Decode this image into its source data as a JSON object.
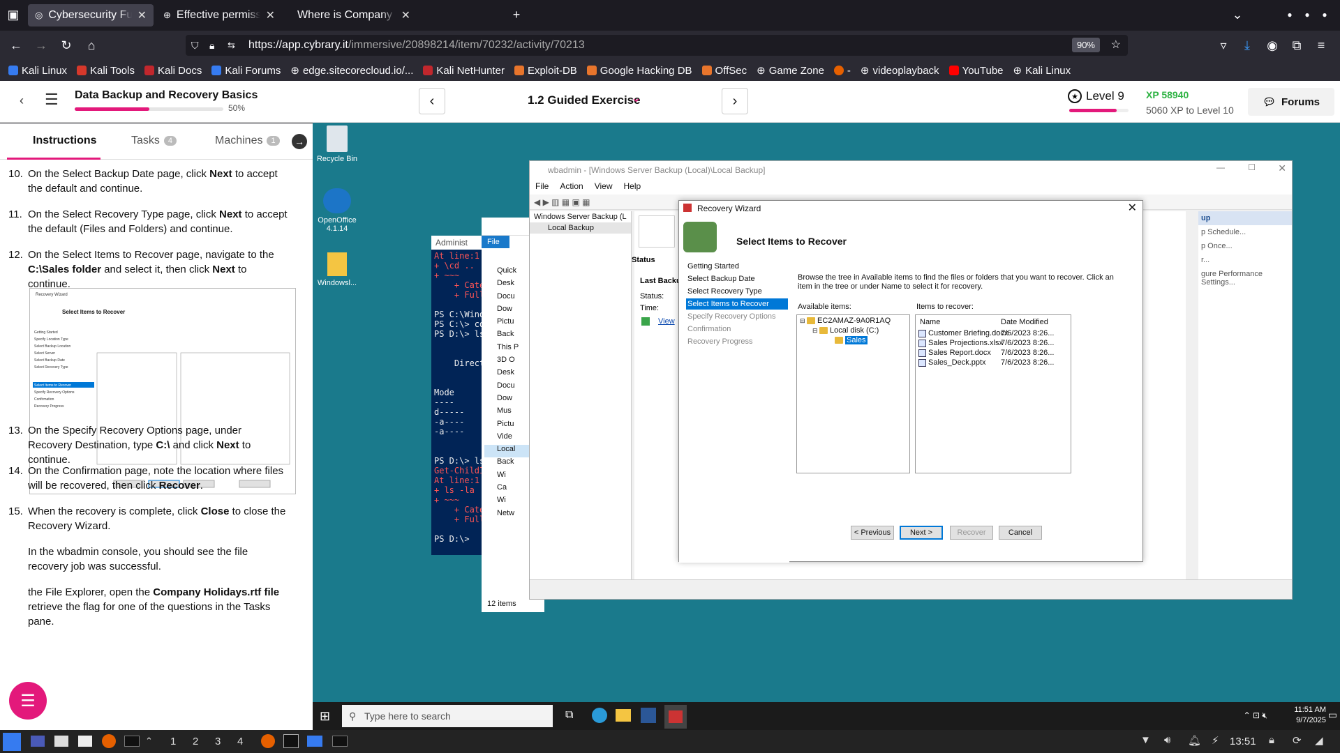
{
  "browser": {
    "tabs": [
      {
        "title": "Cybersecurity Fundamentals",
        "active": true
      },
      {
        "title": "Effective permissions check",
        "active": false
      },
      {
        "title": "Where is Company Holidays",
        "active": false
      }
    ],
    "url_host": "https://app.cybrary.it",
    "url_path": "/immersive/20898214/item/70232/activity/70213",
    "zoom": "90%",
    "bookmarks": [
      "Kali Linux",
      "Kali Tools",
      "Kali Docs",
      "Kali Forums",
      "edge.sitecorecloud.io/...",
      "Kali NetHunter",
      "Exploit-DB",
      "Google Hacking DB",
      "OffSec",
      "Game Zone",
      "-",
      "videoplayback",
      "YouTube",
      "Kali Linux"
    ]
  },
  "header": {
    "course_title": "Data Backup and Recovery Basics",
    "progress_pct": "50%",
    "progress_value": 0.5,
    "exercise": "1.2 Guided Exercise",
    "level": "Level 9",
    "xp": "XP 58940",
    "xp_to_level": "5060 XP to Level 10",
    "forums": "Forums"
  },
  "left": {
    "tabs": {
      "instructions": "Instructions",
      "tasks": "Tasks",
      "tasks_count": "4",
      "machines": "Machines",
      "machines_count": "1"
    },
    "steps": [
      {
        "n": "10.",
        "pre": "On the Select Backup Date page, click ",
        "b": "Next",
        "post": " to accept the default and continue."
      },
      {
        "n": "11.",
        "pre": "On the Select Recovery Type page, click ",
        "b": "Next",
        "post": " to accept the default (Files and Folders) and continue."
      },
      {
        "n": "12.",
        "pre": "On the Select Items to Recover page, navigate to the ",
        "b": "C:\\Sales folder",
        "mid": " and select it, then click ",
        "b2": "Next",
        "post": " to continue."
      },
      {
        "n": "13.",
        "pre": "On the Specify Recovery Options page, under Recovery Destination, type ",
        "b": "C:\\",
        "mid": " and click ",
        "b2": "Next",
        "post": " to continue."
      },
      {
        "n": "14.",
        "pre": "On the Confirmation page, note the location where files will be recovered, then click ",
        "b": "Recover",
        "post": "."
      },
      {
        "n": "15.",
        "pre": "When the recovery is complete, click ",
        "b": "Close",
        "post": " to close the Recovery Wizard."
      }
    ],
    "note": "In the wbadmin console, you should see the file recovery job was successful.",
    "step16_a": "the File Explorer, open the ",
    "step16_b": "Company Holidays.rtf file",
    "step16_c": " retrieve the flag for one of the questions in the Tasks pane."
  },
  "desktop": {
    "icons": [
      "Recycle Bin",
      "OpenOffice 4.1.14",
      "Windowsl..."
    ],
    "powershell_title": "Administ",
    "powershell_lines": [
      "At line:1",
      "+ \\cd ..",
      "+ ~~~",
      "    + Cate",
      "    + Full",
      "",
      "PS C:\\Wind",
      "PS C:\\> cd",
      "PS D:\\> ls",
      "",
      "",
      "    Direct",
      "",
      "",
      "Mode",
      "----",
      "d-----",
      "-a----",
      "-a----",
      "",
      "",
      "PS D:\\> ls",
      "Get-ChildI",
      "At line:1",
      "+ ls -la",
      "+ ~~~",
      "    + Cate",
      "    + Full",
      "",
      "PS D:\\>"
    ],
    "explorer_items": [
      "Quick",
      "Desk",
      "Docu",
      "Dow",
      "Pictu",
      "Back",
      "This P",
      "3D O",
      "Desk",
      "Docu",
      "Dow",
      "Mus",
      "Pictu",
      "Vide",
      "Local",
      "Back",
      "Wi",
      "Ca",
      "Wi",
      "Netw"
    ],
    "explorer_file": "File",
    "explorer_count": "12 items",
    "wbadmin": {
      "title": "wbadmin - [Windows Server Backup (Local)\\Local Backup]",
      "menu": [
        "File",
        "Action",
        "View",
        "Help"
      ],
      "tree": [
        "Windows Server Backup (L",
        "Local Backup"
      ],
      "status": "Status",
      "last_backup": "Last Backu",
      "status_lbl": "Status:",
      "time_lbl": "Time:",
      "view_link": "View",
      "actions_header": "up",
      "actions": [
        "p Schedule...",
        "p Once...",
        "r...",
        "gure Performance Settings..."
      ]
    },
    "wizard": {
      "title": "Recovery Wizard",
      "heading": "Select Items to Recover",
      "steps": [
        "Getting Started",
        "Select Backup Date",
        "Select Recovery Type",
        "Select Items to Recover",
        "Specify Recovery Options",
        "Confirmation",
        "Recovery Progress"
      ],
      "description": "Browse the tree in Available items to find the files or folders that you want to recover. Click an item in the tree or under Name to select it for recovery.",
      "available_label": "Available items:",
      "recover_label": "Items to recover:",
      "tree": [
        "EC2AMAZ-9A0R1AQ",
        "Local disk (C:)",
        "Sales"
      ],
      "col_name": "Name",
      "col_date": "Date Modified",
      "files": [
        {
          "name": "Customer Briefing.docx",
          "date": "7/6/2023 8:26..."
        },
        {
          "name": "Sales Projections.xlsx",
          "date": "7/6/2023 8:26..."
        },
        {
          "name": "Sales Report.docx",
          "date": "7/6/2023 8:26..."
        },
        {
          "name": "Sales_Deck.pptx",
          "date": "7/6/2023 8:26..."
        }
      ],
      "btn_prev": "< Previous",
      "btn_next": "Next >",
      "btn_recover": "Recover",
      "btn_cancel": "Cancel"
    },
    "taskbar": {
      "search": "Type here to search",
      "time": "11:51 AM",
      "date": "9/7/2025"
    }
  },
  "kali_panel": {
    "workspaces": [
      "1",
      "2",
      "3",
      "4"
    ],
    "clock": "13:51"
  }
}
